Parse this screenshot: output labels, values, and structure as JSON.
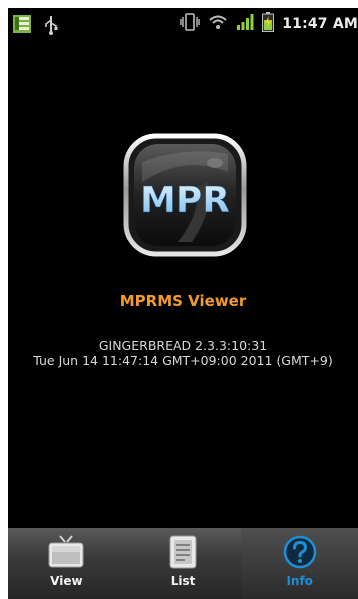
{
  "status_bar": {
    "time": "11:47 AM",
    "icons": [
      "notification-icon",
      "usb-icon",
      "vibrate-icon",
      "wifi-icon",
      "signal-icon",
      "battery-charging-icon"
    ]
  },
  "app": {
    "logo_text": "MPR",
    "name": "MPRMS Viewer",
    "build": "GINGERBREAD 2.3.3:10:31",
    "date": "Tue Jun 14 11:47:14 GMT+09:00 2011 (GMT+9)"
  },
  "tabs": [
    {
      "label": "View",
      "icon": "tv-icon",
      "active": false
    },
    {
      "label": "List",
      "icon": "list-icon",
      "active": false
    },
    {
      "label": "Info",
      "icon": "help-icon",
      "active": true
    }
  ],
  "colors": {
    "accent": "#f19b2d",
    "active_tab": "#1d8fd6",
    "background": "#000000"
  }
}
